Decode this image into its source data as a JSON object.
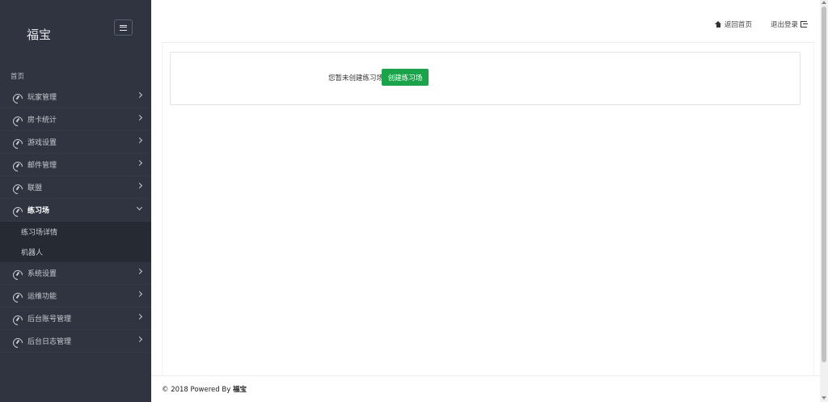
{
  "sidebar": {
    "brand": "福宝",
    "home_label": "首页",
    "items": [
      {
        "label": "玩家管理",
        "icon": "dashboard-icon"
      },
      {
        "label": "房卡统计",
        "icon": "dashboard-icon"
      },
      {
        "label": "游戏设置",
        "icon": "dashboard-icon"
      },
      {
        "label": "邮件管理",
        "icon": "dashboard-icon"
      },
      {
        "label": "联盟",
        "icon": "dashboard-icon"
      },
      {
        "label": "练习场",
        "icon": "dashboard-icon",
        "open": true
      },
      {
        "label": "系统设置",
        "icon": "dashboard-icon"
      },
      {
        "label": "运维功能",
        "icon": "dashboard-icon"
      },
      {
        "label": "后台账号管理",
        "icon": "dashboard-icon"
      },
      {
        "label": "后台日志管理",
        "icon": "dashboard-icon"
      }
    ],
    "sub_items": [
      "练习场详情",
      "机器人"
    ]
  },
  "topbar": {
    "home_link": "返回首页",
    "logout_link": "退出登录"
  },
  "main": {
    "empty_text": "您暂未创建练习场",
    "create_button": "创建练习场"
  },
  "footer": {
    "prefix": "© 2018 Powered By",
    "brand": "福宝"
  },
  "colors": {
    "sidebar_bg": "#2f3440",
    "submenu_bg": "#262a33",
    "primary_button": "#1aa34a"
  }
}
